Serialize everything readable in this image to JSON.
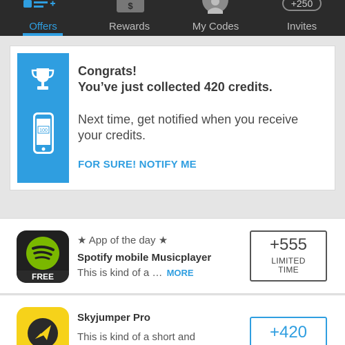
{
  "nav": {
    "items": [
      {
        "label": "Offers",
        "icon": "list-plus-icon"
      },
      {
        "label": "Rewards",
        "icon": "dollar-tag-icon",
        "glyph": "$"
      },
      {
        "label": "My Codes",
        "icon": "avatar-icon"
      },
      {
        "label": "Invites",
        "icon": "invite-badge-icon",
        "badge": "+250"
      }
    ],
    "active": "Offers"
  },
  "notification": {
    "line1": "Congrats!",
    "line2": "You’ve just collected 420 credits.",
    "body": "Next time, get notified when you receive your credits.",
    "phone_value": "100",
    "link": "FOR SURE! NOTIFY ME"
  },
  "offers": [
    {
      "tag": "★ App of the day ★",
      "title": "Spotify mobile Musicplayer",
      "desc": "This is kind of a …",
      "more": "MORE",
      "badge": "FREE",
      "credits": "+555",
      "credits_sub_1": "LIMITED",
      "credits_sub_2": "TIME"
    },
    {
      "title": "Skyjumper Pro",
      "desc": "This is kind of a short and",
      "credits": "+420"
    }
  ],
  "colors": {
    "accent": "#2f9ee0",
    "nav_bg": "#2b2b2b",
    "spotify_green": "#7ab800",
    "skyjumper_yellow": "#f6d21a"
  }
}
